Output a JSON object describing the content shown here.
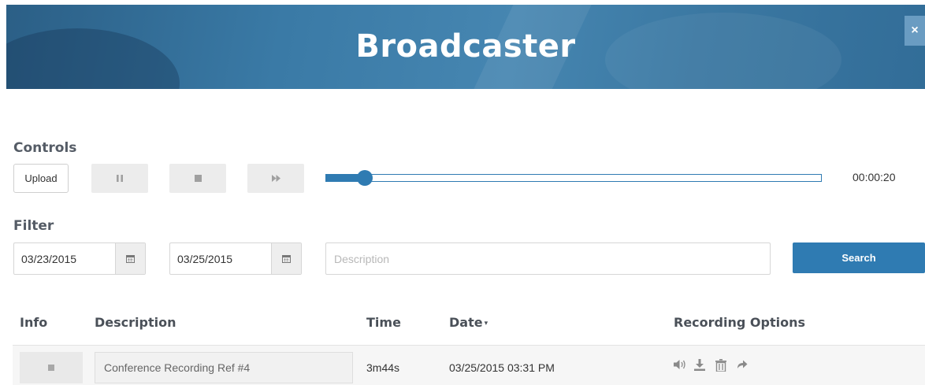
{
  "header": {
    "title": "Broadcaster",
    "close_label": "×"
  },
  "controls": {
    "label": "Controls",
    "upload_label": "Upload",
    "pause_icon": "pause-icon",
    "stop_icon": "stop-icon",
    "forward_icon": "fast-forward-icon",
    "progress": 0.08,
    "time": "00:00:20"
  },
  "filter": {
    "label": "Filter",
    "start_date": "03/23/2015",
    "end_date": "03/25/2015",
    "description_placeholder": "Description",
    "search_label": "Search"
  },
  "table": {
    "headers": {
      "info": "Info",
      "description": "Description",
      "time": "Time",
      "date": "Date",
      "options": "Recording Options"
    },
    "sort_indicator": "▾",
    "rows": [
      {
        "description": "Conference Recording Ref #4",
        "time": "3m44s",
        "date": "03/25/2015 03:31 PM"
      }
    ]
  },
  "colors": {
    "accent": "#2f7bb2",
    "banner": "#3a7aa6"
  }
}
